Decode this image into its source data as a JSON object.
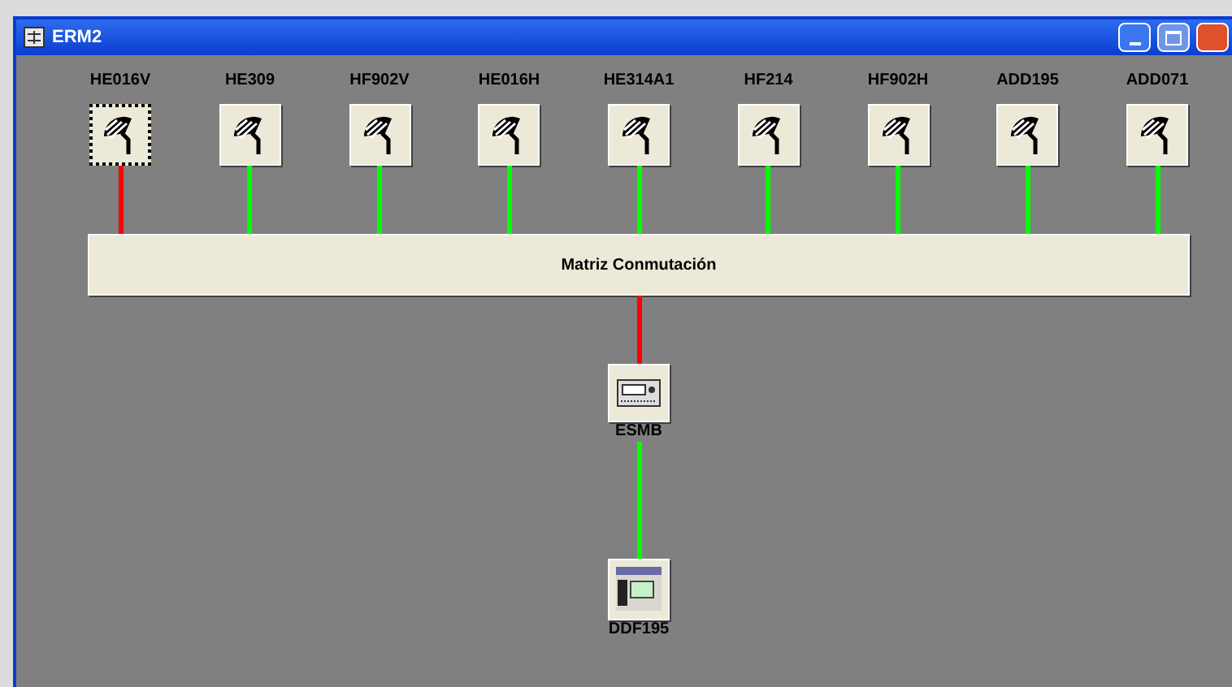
{
  "window": {
    "title": "ERM2"
  },
  "antennas": [
    {
      "label": "HE016V",
      "link_ok": false,
      "selected": true
    },
    {
      "label": "HE309",
      "link_ok": true,
      "selected": false
    },
    {
      "label": "HF902V",
      "link_ok": true,
      "selected": false
    },
    {
      "label": "HE016H",
      "link_ok": true,
      "selected": false
    },
    {
      "label": "HE314A1",
      "link_ok": true,
      "selected": false
    },
    {
      "label": "HF214",
      "link_ok": true,
      "selected": false
    },
    {
      "label": "HF902H",
      "link_ok": true,
      "selected": false
    },
    {
      "label": "ADD195",
      "link_ok": true,
      "selected": false
    },
    {
      "label": "ADD071",
      "link_ok": true,
      "selected": false
    }
  ],
  "matrix": {
    "label": "Matriz Conmutación",
    "link_ok": false
  },
  "receiver": {
    "label": "ESMB",
    "link_ok": true
  },
  "display": {
    "label": "DDF195"
  }
}
